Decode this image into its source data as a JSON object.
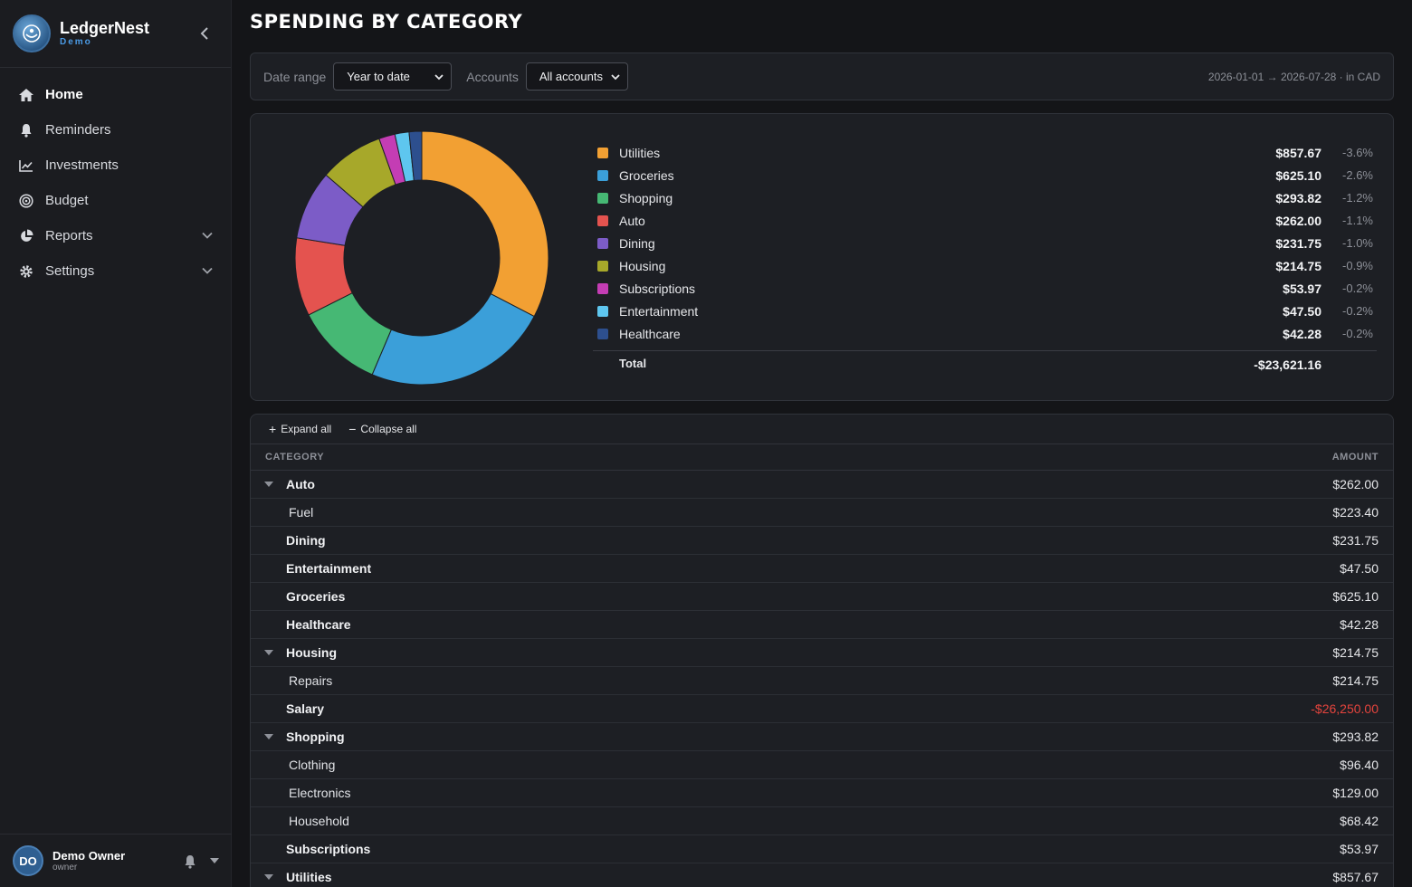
{
  "app": {
    "name": "LedgerNest",
    "tag": "Demo"
  },
  "nav": {
    "home": "Home",
    "reminders": "Reminders",
    "investments": "Investments",
    "budget": "Budget",
    "reports": "Reports",
    "settings": "Settings"
  },
  "user": {
    "initials": "DO",
    "name": "Demo Owner",
    "role": "owner"
  },
  "page": {
    "title": "Spending by Category"
  },
  "filters": {
    "date_label": "Date range",
    "date_value": "Year to date",
    "accounts_label": "Accounts",
    "accounts_value": "All accounts",
    "range_note": "2026-01-01 → 2026-07-28 · in CAD"
  },
  "chart_data": {
    "type": "pie",
    "categories": [
      "Utilities",
      "Groceries",
      "Shopping",
      "Auto",
      "Dining",
      "Housing",
      "Subscriptions",
      "Entertainment",
      "Healthcare"
    ],
    "values": [
      857.67,
      625.1,
      293.82,
      262.0,
      231.75,
      214.75,
      53.97,
      47.5,
      42.28
    ],
    "amounts": [
      "$857.67",
      "$625.10",
      "$293.82",
      "$262.00",
      "$231.75",
      "$214.75",
      "$53.97",
      "$47.50",
      "$42.28"
    ],
    "percents": [
      "-3.6%",
      "-2.6%",
      "-1.2%",
      "-1.1%",
      "-1.0%",
      "-0.9%",
      "-0.2%",
      "-0.2%",
      "-0.2%"
    ],
    "colors": [
      "#f2a033",
      "#3b9fd9",
      "#46b874",
      "#e4534f",
      "#7c5cc7",
      "#a7a82a",
      "#c43db4",
      "#5ec6ef",
      "#2d4f8e"
    ],
    "total_label": "Total",
    "total_amount": "-$23,621.16"
  },
  "table": {
    "expand_label": "Expand all",
    "collapse_label": "Collapse all",
    "col_category": "CATEGORY",
    "col_amount": "AMOUNT",
    "rows": [
      {
        "name": "Auto",
        "amount": "$262.00"
      },
      {
        "name": "Fuel",
        "amount": "$223.40"
      },
      {
        "name": "Dining",
        "amount": "$231.75"
      },
      {
        "name": "Entertainment",
        "amount": "$47.50"
      },
      {
        "name": "Groceries",
        "amount": "$625.10"
      },
      {
        "name": "Healthcare",
        "amount": "$42.28"
      },
      {
        "name": "Housing",
        "amount": "$214.75"
      },
      {
        "name": "Repairs",
        "amount": "$214.75"
      },
      {
        "name": "Salary",
        "amount": "-$26,250.00"
      },
      {
        "name": "Shopping",
        "amount": "$293.82"
      },
      {
        "name": "Clothing",
        "amount": "$96.40"
      },
      {
        "name": "Electronics",
        "amount": "$129.00"
      },
      {
        "name": "Household",
        "amount": "$68.42"
      },
      {
        "name": "Subscriptions",
        "amount": "$53.97"
      },
      {
        "name": "Utilities",
        "amount": "$857.67"
      }
    ]
  }
}
